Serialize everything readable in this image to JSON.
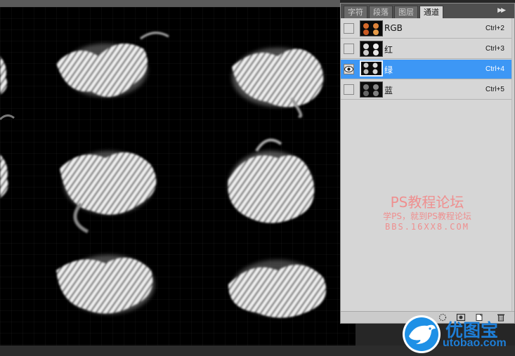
{
  "tabs": [
    {
      "label": "字符",
      "active": false
    },
    {
      "label": "段落",
      "active": false
    },
    {
      "label": "图层",
      "active": false
    },
    {
      "label": "通道",
      "active": true
    }
  ],
  "channels": [
    {
      "name": "RGB",
      "shortcut": "Ctrl+2",
      "visible": false,
      "selected": false
    },
    {
      "name": "红",
      "shortcut": "Ctrl+3",
      "visible": false,
      "selected": false
    },
    {
      "name": "绿",
      "shortcut": "Ctrl+4",
      "visible": true,
      "selected": true
    },
    {
      "name": "蓝",
      "shortcut": "Ctrl+5",
      "visible": false,
      "selected": false
    }
  ],
  "watermark": {
    "title": "PS教程论坛",
    "subtitle": "学PS，就到PS教程论坛",
    "url": "BBS.16XX8.COM"
  },
  "logo": {
    "cn": "优图宝",
    "en": "utobao.com"
  },
  "colors": {
    "selected_row": "#3d97f5",
    "panel_bg": "#d6d6d6",
    "watermark": "#ef8f8f",
    "logo": "#1e7ed6"
  },
  "icons": {
    "panel_menu": "double-chevron-right-icon",
    "visibility": "eye-icon",
    "footer": [
      "dotted-circle-icon",
      "channel-to-selection-icon",
      "save-mask-icon",
      "new-channel-icon",
      "trash-icon"
    ]
  }
}
